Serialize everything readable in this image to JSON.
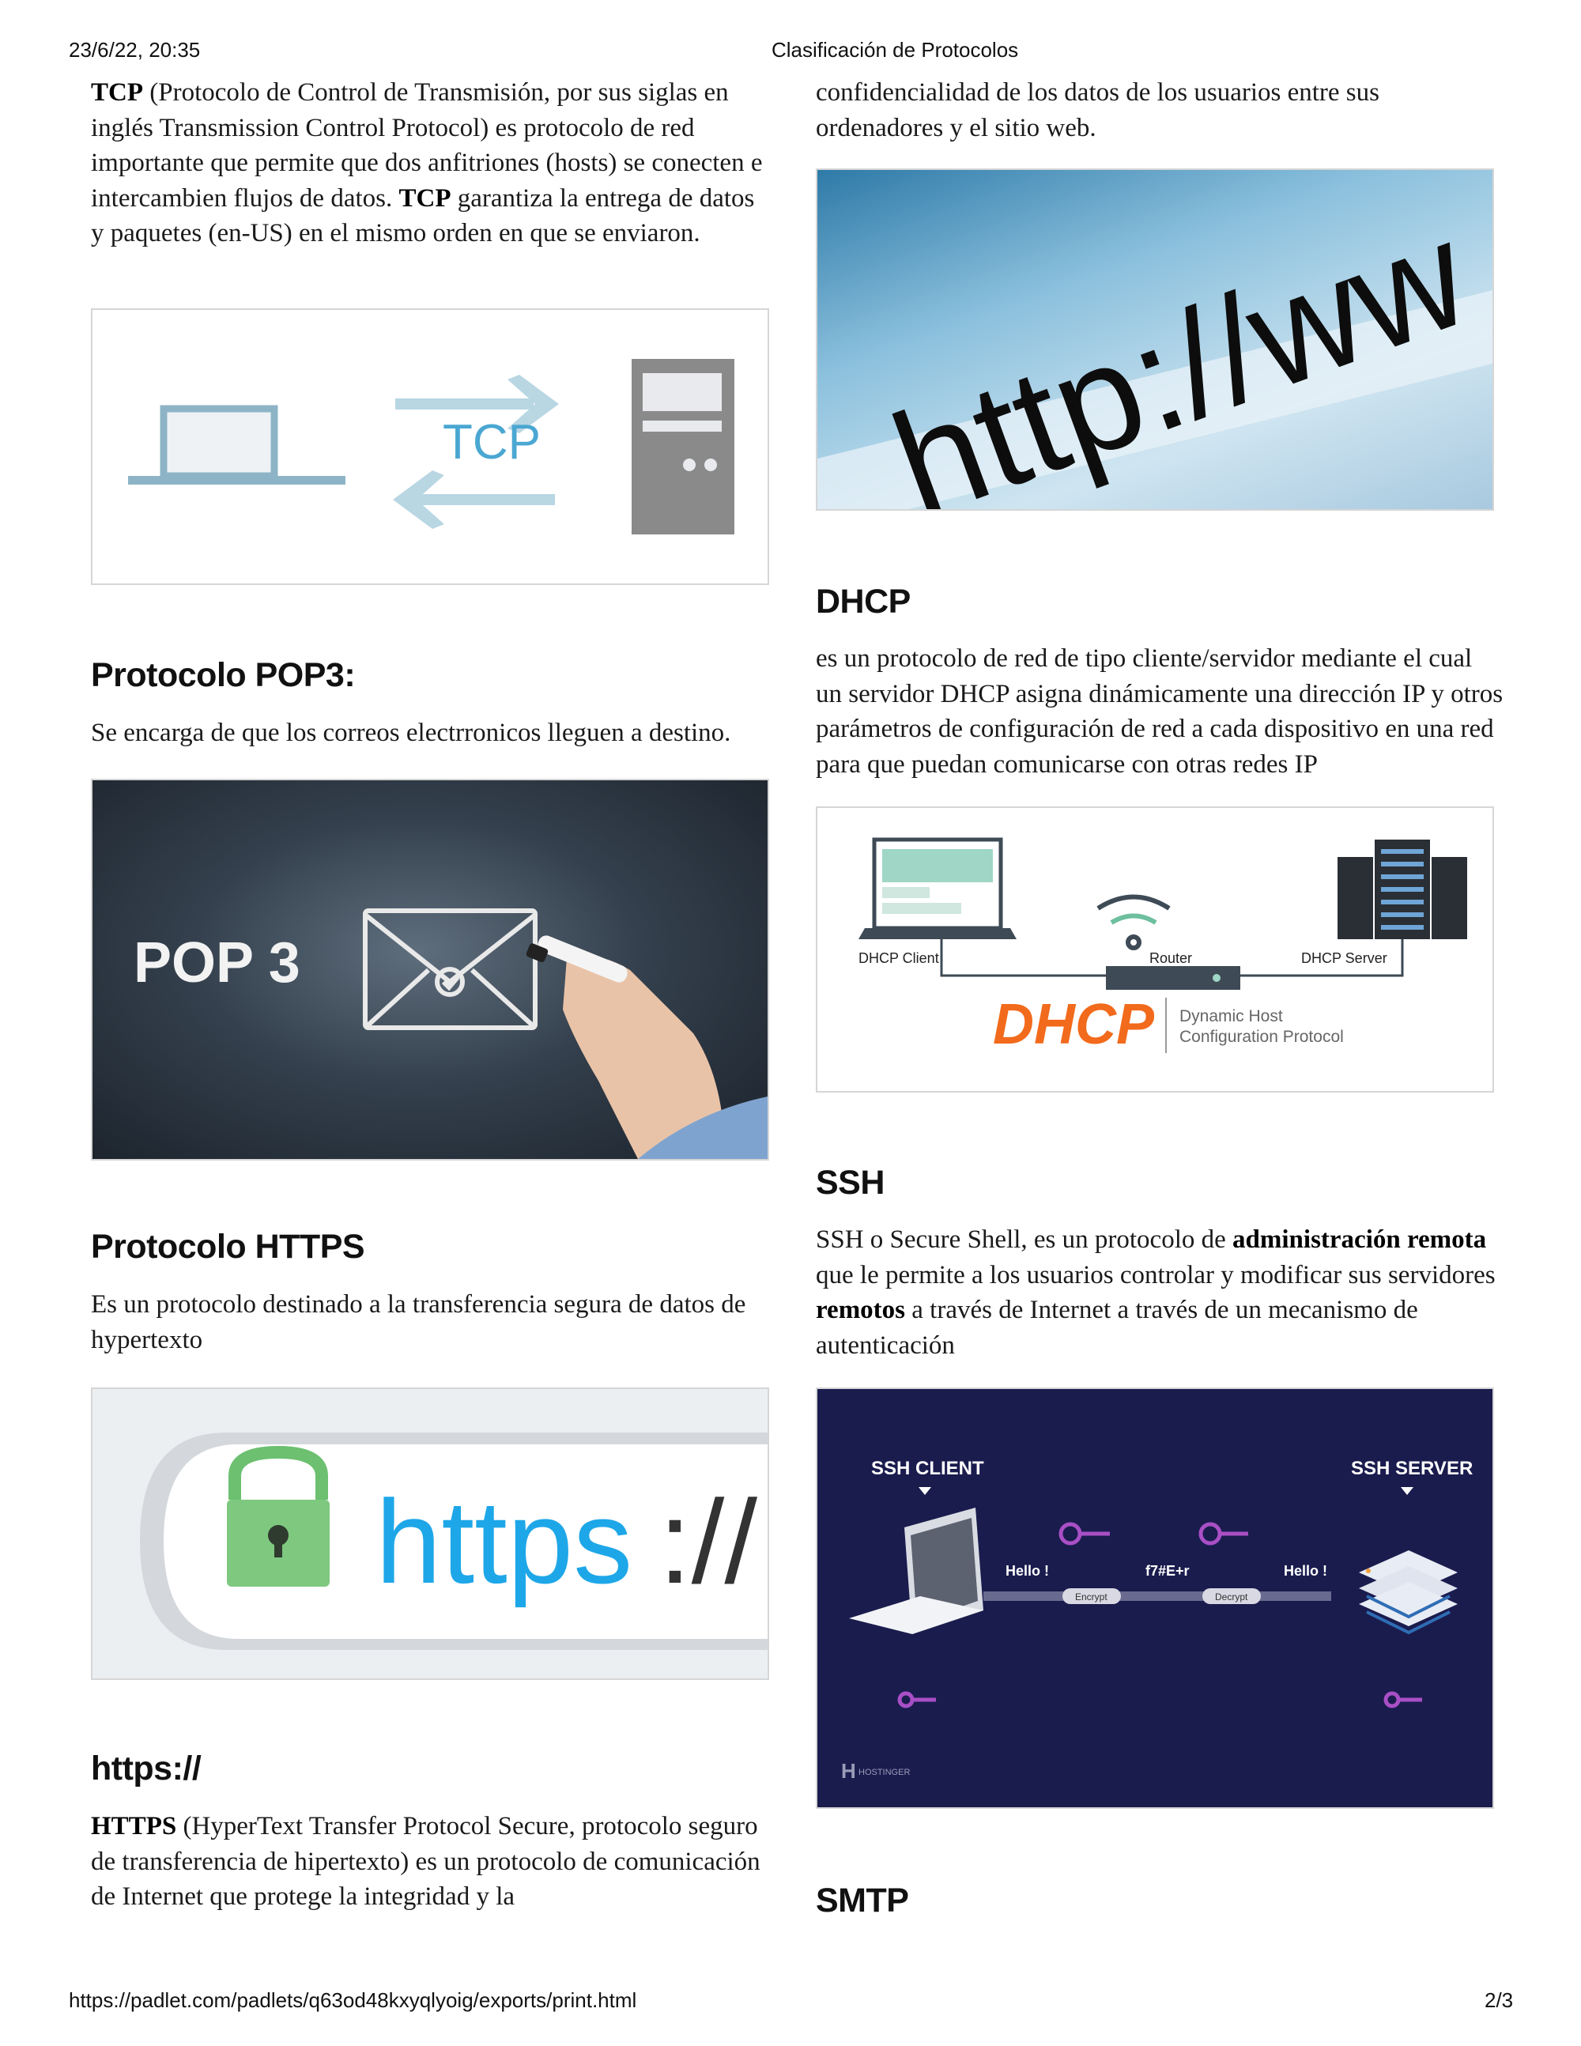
{
  "print_header": {
    "datetime": "23/6/22, 20:35",
    "title": "Clasificación de Protocolos"
  },
  "print_footer": {
    "url": "https://padlet.com/padlets/q63od48kxyqlyoig/exports/print.html",
    "page": "2/3"
  },
  "left_column": {
    "tcp": {
      "p1_bold": "TCP",
      "p1_text": " (Protocolo de Control de Transmisión, por sus siglas en inglés Transmission Control Protocol) es protocolo de red importante que permite que dos anfitriones (hosts) se conecten e intercambien flujos de datos. ",
      "p2_bold": "TCP",
      "p2_text": " garantiza la entrega de datos y paquetes (en-US) en el mismo orden en que se enviaron.",
      "image_label": "TCP"
    },
    "pop3": {
      "heading": "Protocolo POP3:",
      "body": "Se encarga de que los correos electrronicos lleguen a destino.",
      "image_label": "POP 3"
    },
    "https": {
      "heading": "Protocolo HTTPS",
      "body": "Es un protocolo destinado a la transferencia segura  de datos de hypertexto",
      "image_label": "https://"
    },
    "https2": {
      "heading": "https://",
      "bold": "HTTPS",
      "body": " (HyperText Transfer Protocol Secure, protocolo seguro de transferencia de hipertexto) es un protocolo de comunicación de Internet que protege la integridad y la"
    }
  },
  "right_column": {
    "cont": {
      "body": "confidencialidad de los datos de los usuarios entre sus ordenadores y el sitio web."
    },
    "http_image_label": "http://ww",
    "dhcp": {
      "heading": "DHCP",
      "body": "es un protocolo de red de tipo cliente/servidor mediante el cual un servidor DHCP asigna dinámicamente una dirección IP y otros parámetros de configuración de red a cada dispositivo en una red para que puedan comunicarse con otras redes IP",
      "image": {
        "client": "DHCP Client",
        "router": "Router",
        "server": "DHCP Server",
        "logo": "DHCP",
        "line1": "Dynamic Host",
        "line2": "Configuration Protocol"
      }
    },
    "ssh": {
      "heading": "SSH",
      "t1": "SSH o Secure Shell, es un protocolo de ",
      "b1": "administración remota",
      "t2": " que le permite a los usuarios controlar y modificar sus servidores ",
      "b2": "remotos",
      "t3": " a través de Internet a través de un mecanismo de autenticación",
      "image": {
        "client": "SSH CLIENT",
        "server": "SSH SERVER",
        "hello1": "Hello !",
        "cipher": "f7#E+r",
        "hello2": "Hello !",
        "encrypt": "Encrypt",
        "decrypt": "Decrypt",
        "brand": "HOSTINGER"
      }
    },
    "smtp": {
      "heading": "SMTP"
    }
  },
  "colors": {
    "tcp_blue": "#8db4c6",
    "tcp_arrow": "#b9d6e3",
    "server_gray": "#8a8a8a",
    "https_green": "#6cc070",
    "https_blue": "#1ea7e8",
    "dhcp_orange": "#f26a1b",
    "ssh_bg": "#1a1c4e",
    "key_purple": "#a94fc6"
  }
}
